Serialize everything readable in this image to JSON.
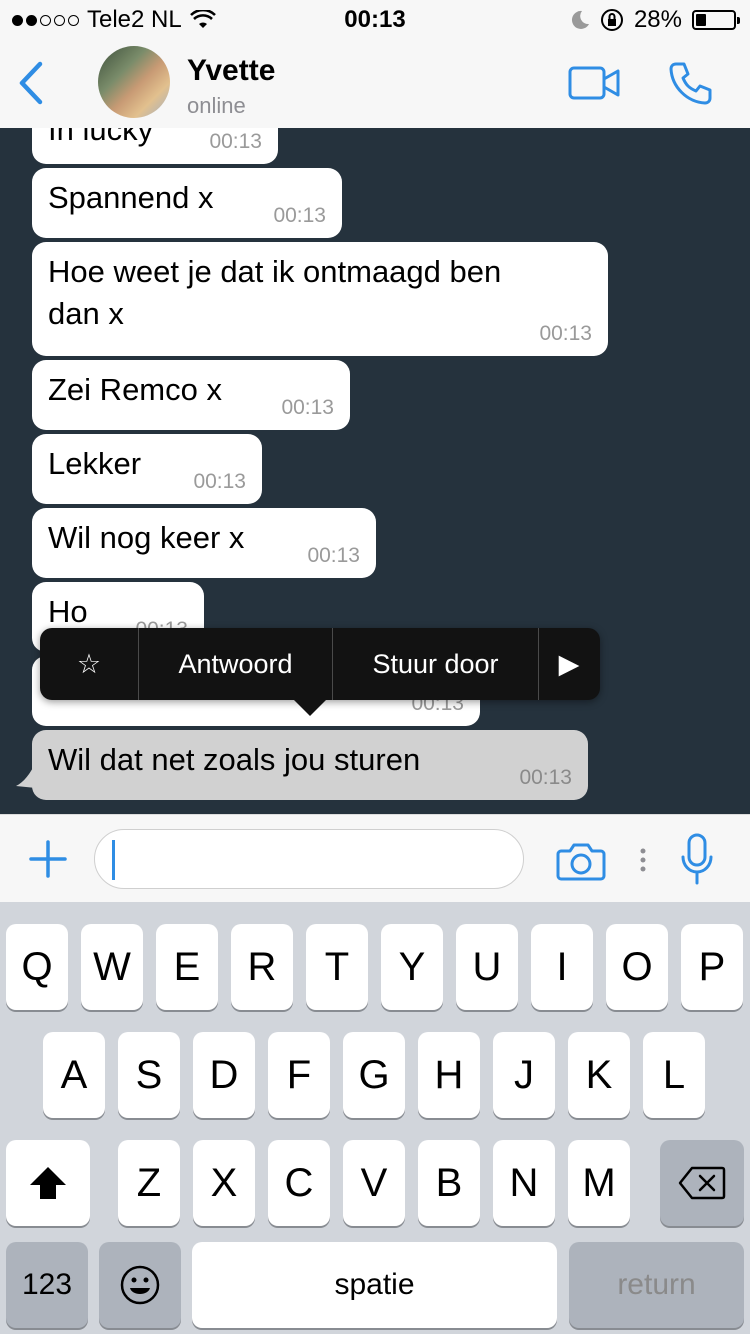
{
  "status_bar": {
    "carrier": "Tele2 NL",
    "time": "00:13",
    "battery": "28%",
    "battery_level": 0.28,
    "signal_bars": 2
  },
  "header": {
    "contact_name": "Yvette",
    "contact_status": "online",
    "icons": [
      "back-chevron-icon",
      "video-call-icon",
      "phone-call-icon"
    ]
  },
  "messages": [
    {
      "text": "In lucky",
      "time": "00:13"
    },
    {
      "text": "Spannend x",
      "time": "00:13"
    },
    {
      "text": "Hoe weet je dat ik ontmaagd ben\ndan x",
      "time": "00:13"
    },
    {
      "text": "Zei Remco x",
      "time": "00:13"
    },
    {
      "text": "Lekker",
      "time": "00:13"
    },
    {
      "text": "Wil nog keer x",
      "time": "00:13"
    },
    {
      "text": "Ho",
      "time": "00:13"
    },
    {
      "text": "",
      "time": "00:13"
    },
    {
      "text": "Wil dat net zoals jou sturen",
      "time": "00:13",
      "selected": true
    }
  ],
  "context_menu": {
    "star": "☆",
    "reply": "Antwoord",
    "forward": "Stuur door",
    "more": "▶"
  },
  "input_bar": {
    "placeholder": "",
    "icons": [
      "plus-icon",
      "camera-icon",
      "more-dots-icon",
      "microphone-icon"
    ]
  },
  "keyboard": {
    "row1": [
      "Q",
      "W",
      "E",
      "R",
      "T",
      "Y",
      "U",
      "I",
      "O",
      "P"
    ],
    "row2": [
      "A",
      "S",
      "D",
      "F",
      "G",
      "H",
      "J",
      "K",
      "L"
    ],
    "row3": [
      "Z",
      "X",
      "C",
      "V",
      "B",
      "N",
      "M"
    ],
    "numbers": "123",
    "space": "spatie",
    "return": "return"
  },
  "colors": {
    "accent": "#2f8de4",
    "chat_background": "#25323d",
    "bubble": "#ffffff",
    "selected_bubble": "#d1d1d1",
    "menu": "#121212",
    "keyboard": "#d1d5db"
  }
}
